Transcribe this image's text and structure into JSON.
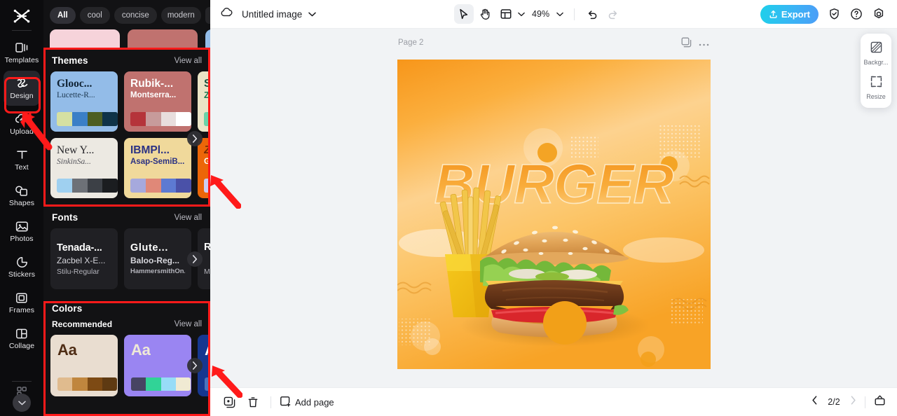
{
  "app": {
    "name": "CapCut",
    "logo_icon": "capcut-logo-icon"
  },
  "sidebar": {
    "items": [
      {
        "label": "Templates",
        "icon": "templates-icon",
        "active": false
      },
      {
        "label": "Design",
        "icon": "design-icon",
        "active": true
      },
      {
        "label": "Upload",
        "icon": "upload-cloud-icon",
        "active": false
      },
      {
        "label": "Text",
        "icon": "text-icon",
        "active": false
      },
      {
        "label": "Shapes",
        "icon": "shapes-icon",
        "active": false
      },
      {
        "label": "Photos",
        "icon": "photos-icon",
        "active": false
      },
      {
        "label": "Stickers",
        "icon": "stickers-icon",
        "active": false
      },
      {
        "label": "Frames",
        "icon": "frames-icon",
        "active": false
      },
      {
        "label": "Collage",
        "icon": "collage-icon",
        "active": false
      }
    ],
    "more_icon": "apps-grid-icon",
    "expand_icon": "chevron-down-icon"
  },
  "panel": {
    "filters": [
      {
        "label": "All",
        "selected": true
      },
      {
        "label": "cool",
        "selected": false
      },
      {
        "label": "concise",
        "selected": false
      },
      {
        "label": "modern",
        "selected": false
      }
    ],
    "filter_more_icon": "chevron-down-icon",
    "themes": {
      "title": "Themes",
      "view_all": "View all",
      "cards": [
        {
          "title": "Glooc...",
          "subtitle": "Lucette-R...",
          "bg": "#93bce8",
          "title_color": "#102334",
          "sub_color": "#1d3850",
          "swatches": [
            "#d5e0a2",
            "#3a7fc7",
            "#4d5e22",
            "#0f3348"
          ]
        },
        {
          "title": "Rubik-...",
          "subtitle": "Montserra...",
          "bg": "#c0726f",
          "title_color": "#ffffff",
          "sub_color": "#ffffff",
          "swatches": [
            "#b5343a",
            "#c79b9b",
            "#e8dedd",
            "#ffffff"
          ]
        },
        {
          "title": "Sp",
          "subtitle": "ZY",
          "bg": "#eae4c6",
          "title_color": "#1c5442",
          "sub_color": "#1c7a52",
          "swatches": [
            "#6ad3a8",
            "#8fdcc0",
            "#cdebdd",
            "#f2f6ee"
          ]
        },
        {
          "title": "New Y...",
          "subtitle": "SinkinSa...",
          "bg": "#ece9e2",
          "title_color": "#26262a",
          "sub_color": "#55555c",
          "swatches": [
            "#9fd0f0",
            "#6d7177",
            "#3c4046",
            "#1b1d20"
          ]
        },
        {
          "title": "IBMPl...",
          "subtitle": "Asap-SemiB...",
          "bg": "#f0d99b",
          "title_color": "#2b3284",
          "sub_color": "#2b3284",
          "swatches": [
            "#a6a9dd",
            "#e08878",
            "#5d7ad2",
            "#4a51a8"
          ]
        },
        {
          "title": "Z",
          "subtitle": "Gro",
          "bg": "#ec6608",
          "title_color": "#7a2c03",
          "sub_color": "#ffffff",
          "swatches": [
            "#cdcdf2",
            "#d8d8f6",
            "#e4e4fa",
            "#f0f0fd"
          ]
        }
      ],
      "next_icon": "chevron-right-icon"
    },
    "fonts": {
      "title": "Fonts",
      "view_all": "View all",
      "cards": [
        {
          "line1": "Tenada-...",
          "line2": "Zacbel X-E...",
          "line3": "Stilu-Regular"
        },
        {
          "line1": "Glute...",
          "line2": "Baloo-Reg...",
          "line3": "HammersmithOn..."
        },
        {
          "line1": "Ru",
          "line2": "",
          "line3": "Mor"
        }
      ],
      "next_icon": "chevron-right-icon"
    },
    "colors": {
      "title": "Colors",
      "subsection": "Recommended",
      "view_all": "View all",
      "cards": [
        {
          "sample": "Aa",
          "bg": "#e9ddd0",
          "text_color": "#4f2d15",
          "swatches": [
            "#e0bb8e",
            "#c0863e",
            "#7d4a14",
            "#5e3a12"
          ]
        },
        {
          "sample": "Aa",
          "bg": "#9a85f2",
          "text_color": "#efe9d7",
          "swatches": [
            "#474463",
            "#31d397",
            "#97dcf7",
            "#f0ead3"
          ]
        },
        {
          "sample": "A",
          "bg": "#16378f",
          "text_color": "#ffffff",
          "swatches": [
            "#4a74bd",
            "#5a85c9",
            "#6a93d2",
            "#7aa1da"
          ]
        }
      ],
      "next_icon": "chevron-right-icon"
    }
  },
  "toolbar": {
    "cloud_icon": "cloud-sync-icon",
    "title": "Untitled image",
    "title_caret_icon": "chevron-down-icon",
    "tools": [
      {
        "name": "select",
        "icon": "cursor-arrow-icon",
        "active": true
      },
      {
        "name": "hand",
        "icon": "hand-icon",
        "active": false
      },
      {
        "name": "layout",
        "icon": "layout-panel-icon",
        "active": false
      }
    ],
    "layout_caret_icon": "chevron-down-icon",
    "zoom_caret_icon": "chevron-down-icon",
    "zoom": "49%",
    "undo_icon": "undo-icon",
    "redo_icon": "redo-icon",
    "export_label": "Export",
    "export_icon": "upload-arrow-icon",
    "export_color": "#2bbdf0",
    "right_icons": [
      {
        "name": "shield-check-icon"
      },
      {
        "name": "help-circle-icon"
      },
      {
        "name": "settings-gear-icon"
      }
    ]
  },
  "canvas": {
    "page_label": "Page 2",
    "duplicate_icon": "duplicate-page-icon",
    "more_icon": "more-horizontal-icon",
    "artwork": {
      "headline": "BURGER",
      "bg_top": "#f79b1e",
      "bg_mid": "#fdd08a",
      "bg_bottom": "#f9a72c",
      "accent": "#f59b16"
    }
  },
  "right_panel": {
    "items": [
      {
        "label": "Backgr...",
        "icon": "background-swatch-icon"
      },
      {
        "label": "Resize",
        "icon": "resize-icon"
      }
    ]
  },
  "bottombar": {
    "duplicate_icon": "duplicate-icon",
    "delete_icon": "trash-icon",
    "add_page_label": "Add page",
    "add_page_icon": "add-page-icon",
    "prev_icon": "chevron-left-icon",
    "next_icon": "chevron-right-icon",
    "page_indicator": "2/2",
    "collapse_icon": "collapse-panel-icon"
  },
  "annotations": {
    "highlight_color": "#ff1a1a",
    "boxes": [
      "design-sidebar-item",
      "themes-section",
      "colors-section"
    ],
    "arrows": [
      "arrow-to-design",
      "arrow-to-themes",
      "arrow-to-colors"
    ]
  }
}
